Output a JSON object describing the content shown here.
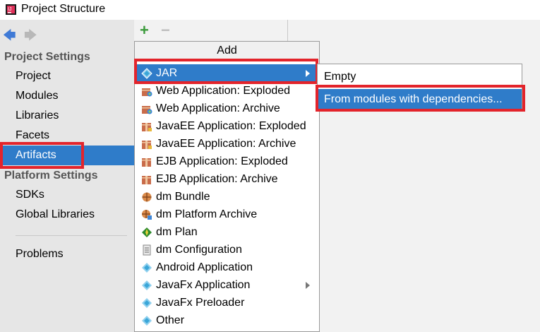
{
  "window": {
    "title": "Project Structure",
    "app_icon": "intellij-icon"
  },
  "sidebar": {
    "back_icon": "back-arrow-icon",
    "forward_icon": "forward-arrow-icon",
    "project_settings_heading": "Project Settings",
    "project_settings_items": [
      "Project",
      "Modules",
      "Libraries",
      "Facets",
      "Artifacts"
    ],
    "platform_settings_heading": "Platform Settings",
    "platform_settings_items": [
      "SDKs",
      "Global Libraries"
    ],
    "problems_label": "Problems",
    "selected_item": "Artifacts"
  },
  "toolbar": {
    "add_icon": "plus-icon",
    "remove_icon": "minus-icon"
  },
  "add_menu": {
    "header": "Add",
    "items": [
      {
        "label": "JAR",
        "icon": "jar-icon",
        "has_submenu": true,
        "selected": true
      },
      {
        "label": "Web Application: Exploded",
        "icon": "web-app-icon"
      },
      {
        "label": "Web Application: Archive",
        "icon": "web-app-icon"
      },
      {
        "label": "JavaEE Application: Exploded",
        "icon": "javaee-icon"
      },
      {
        "label": "JavaEE Application: Archive",
        "icon": "javaee-icon"
      },
      {
        "label": "EJB Application: Exploded",
        "icon": "ejb-icon"
      },
      {
        "label": "EJB Application: Archive",
        "icon": "ejb-icon"
      },
      {
        "label": "dm Bundle",
        "icon": "dm-bundle-icon"
      },
      {
        "label": "dm Platform Archive",
        "icon": "dm-platform-icon"
      },
      {
        "label": "dm Plan",
        "icon": "dm-plan-icon"
      },
      {
        "label": "dm Configuration",
        "icon": "dm-config-icon"
      },
      {
        "label": "Android Application",
        "icon": "android-icon"
      },
      {
        "label": "JavaFx Application",
        "icon": "javafx-icon",
        "has_submenu": true
      },
      {
        "label": "JavaFx Preloader",
        "icon": "javafx-icon"
      },
      {
        "label": "Other",
        "icon": "other-icon"
      }
    ]
  },
  "jar_submenu": {
    "items": [
      {
        "label": "Empty"
      },
      {
        "label": "From modules with dependencies...",
        "selected": true
      }
    ]
  },
  "colors": {
    "selection": "#2f7cc9",
    "highlight_box": "#e3242b"
  }
}
